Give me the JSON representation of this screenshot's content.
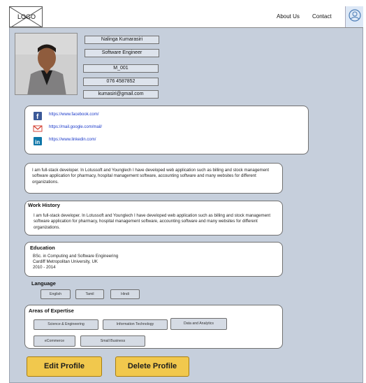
{
  "header": {
    "logo_text": "LOGO",
    "nav": {
      "about_label": "About Us",
      "contact_label": "Contact"
    }
  },
  "profile": {
    "name": "Nalinga Kumarasiri",
    "title": "Software Engineer",
    "id": "M_001",
    "phone": "076 4587852",
    "email": "kumasiri@gmail.com"
  },
  "social_links": [
    {
      "icon": "facebook-icon",
      "url": "https://www.facebook.com/"
    },
    {
      "icon": "gmail-icon",
      "url": "https://mail.google.com/mail/"
    },
    {
      "icon": "linkedin-icon",
      "url": "https://www.linkedin.com/"
    }
  ],
  "about": {
    "text": "I am full-stack developer. In Lotussoft and Younglech I have developed web application such as billing and stock management software application for pharmacy, hospital management software, accounting software and many websites for different organizations."
  },
  "work_history": {
    "title": "Work History",
    "text": "I am full-stack developer. In Lotussoft and Younglech I have developed web application such as billing and stock management software application for pharmacy, hospital management software, accounting software and many websites for different organizations."
  },
  "education": {
    "title": "Education",
    "degree": "BSc. in Computing and Software Engineering",
    "university": "Cardiff Metropolitan University, UK",
    "years": "2010 - 2014"
  },
  "languages": {
    "title": "Language",
    "items": [
      "English",
      "Tamil",
      "Hindi"
    ]
  },
  "expertise": {
    "title": "Areas of Expertise",
    "items": [
      "Science & Engineering",
      "Information Technology",
      "Data and Analytics",
      "eCommerce",
      "Small Business"
    ]
  },
  "actions": {
    "edit_label": "Edit Profile",
    "delete_label": "Delete Profile"
  },
  "colors": {
    "background": "#c6cfdc",
    "card": "#ffffff",
    "button": "#f1c84d",
    "link": "#1a39c9",
    "facebook": "#3b5998",
    "linkedin": "#0e76a8",
    "gmail": "#d44638"
  }
}
